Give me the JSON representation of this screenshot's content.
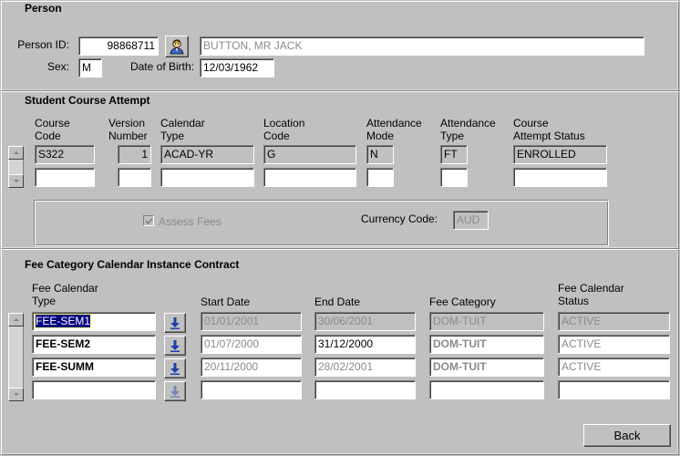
{
  "person": {
    "title": "Person",
    "person_id_label": "Person ID:",
    "person_id": "98868711",
    "name": "BUTTON, MR JACK",
    "sex_label": "Sex:",
    "sex": "M",
    "dob_label": "Date of Birth:",
    "dob": "12/03/1962",
    "person_icon": "person-lookup-icon"
  },
  "course_attempt": {
    "title": "Student Course Attempt",
    "headers": {
      "course_code": [
        "Course",
        "Code"
      ],
      "version_number": [
        "Version",
        "Number"
      ],
      "calendar_type": [
        "Calendar",
        "Type"
      ],
      "location_code": [
        "Location",
        "Code"
      ],
      "attendance_mode": [
        "Attendance",
        "Mode"
      ],
      "attendance_type": [
        "Attendance",
        "Type"
      ],
      "status": [
        "Course",
        "Attempt Status"
      ]
    },
    "rows": [
      {
        "course_code": "S322",
        "version_number": "1",
        "calendar_type": "ACAD-YR",
        "location_code": "G",
        "attendance_mode": "N",
        "attendance_type": "FT",
        "status": "ENROLLED"
      },
      {
        "course_code": "",
        "version_number": "",
        "calendar_type": "",
        "location_code": "",
        "attendance_mode": "",
        "attendance_type": "",
        "status": ""
      }
    ],
    "assess_fees_label": "Assess Fees",
    "assess_fees_checked": true,
    "currency_code_label": "Currency Code:",
    "currency_code": "AUD"
  },
  "fee_contract": {
    "title": "Fee Category Calendar Instance Contract",
    "headers": {
      "fee_cal_type": [
        "Fee Calendar",
        "Type"
      ],
      "start_date": "Start Date",
      "end_date": "End Date",
      "fee_category": "Fee Category",
      "fee_cal_status": [
        "Fee Calendar",
        "Status"
      ]
    },
    "rows": [
      {
        "fee_cal_type": "FEE-SEM1",
        "start_date": "01/01/2001",
        "end_date": "30/06/2001",
        "fee_category": "DOM-TUIT",
        "status": "ACTIVE"
      },
      {
        "fee_cal_type": "FEE-SEM2",
        "start_date": "01/07/2000",
        "end_date": "31/12/2000",
        "fee_category": "DOM-TUIT",
        "status": "ACTIVE"
      },
      {
        "fee_cal_type": "FEE-SUMM",
        "start_date": "20/11/2000",
        "end_date": "28/02/2001",
        "fee_category": "DOM-TUIT",
        "status": "ACTIVE"
      },
      {
        "fee_cal_type": "",
        "start_date": "",
        "end_date": "",
        "fee_category": "",
        "status": ""
      }
    ],
    "lov_icon": "download-arrow-icon"
  },
  "footer": {
    "back_label": "Back"
  },
  "colors": {
    "window_bg": "#c0c0c0",
    "selection_bg": "#000080",
    "disabled_text": "#8a8a8a",
    "icon_blue": "#1f3fa8"
  }
}
